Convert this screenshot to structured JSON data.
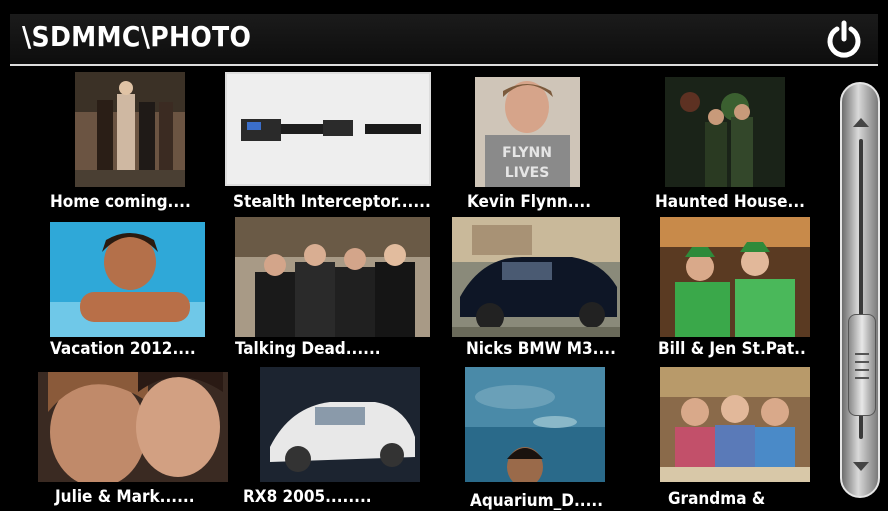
{
  "header": {
    "path": "\\SDMMC\\PHOTO",
    "power_icon": "power-icon"
  },
  "photos": [
    {
      "caption": "Home coming....",
      "thumb": "group-portrait"
    },
    {
      "caption": "Stealth Interceptor......",
      "thumb": "product-device"
    },
    {
      "caption": "Kevin Flynn....",
      "thumb": "person-shirt"
    },
    {
      "caption": "Haunted House...",
      "thumb": "dark-scene"
    },
    {
      "caption": "Vacation 2012....",
      "thumb": "pool"
    },
    {
      "caption": "Talking Dead......",
      "thumb": "group-photo"
    },
    {
      "caption": "Nicks BMW M3....",
      "thumb": "car-dark"
    },
    {
      "caption": "Bill & Jen St.Pat..",
      "thumb": "party-green"
    },
    {
      "caption": "Julie & Mark......",
      "thumb": "couple"
    },
    {
      "caption": "RX8 2005........",
      "thumb": "car-silver"
    },
    {
      "caption": "Aquarium_D.....",
      "thumb": "aquarium"
    },
    {
      "caption": "Grandma &",
      "thumb": "family-table"
    }
  ],
  "scrollbar": {
    "position": 0.55
  }
}
